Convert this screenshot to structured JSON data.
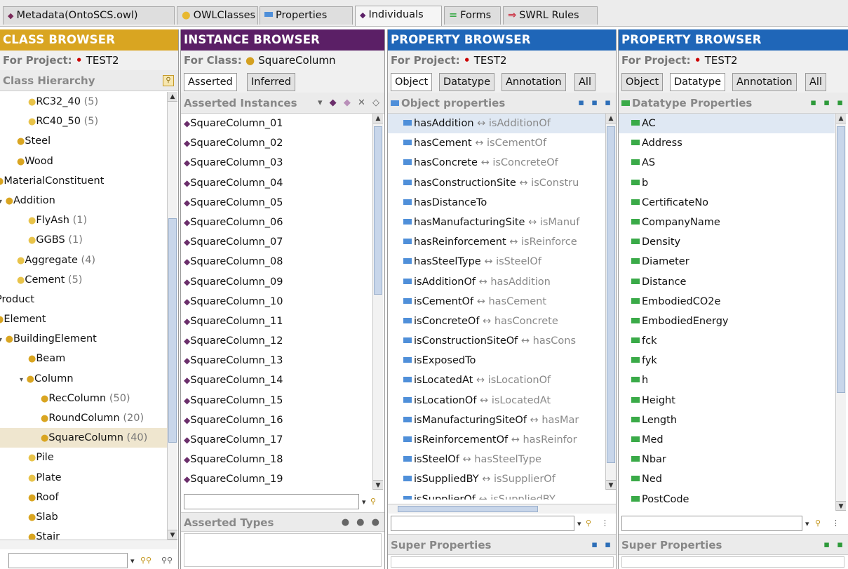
{
  "tabs": [
    {
      "label": "Metadata(OntoSCS.owl)",
      "icon": "purple-diamond"
    },
    {
      "label": "OWLClasses",
      "icon": "gold-circle"
    },
    {
      "label": "Properties",
      "icon": "blue-rect"
    },
    {
      "label": "Individuals",
      "icon": "purple-diamond",
      "active": true
    },
    {
      "label": "Forms",
      "icon": "green-lines"
    },
    {
      "label": "SWRL Rules",
      "icon": "red-arrow"
    }
  ],
  "class_browser": {
    "title": "CLASS BROWSER",
    "for_project_label": "For Project:",
    "project_name": "TEST2",
    "hierarchy_label": "Class Hierarchy",
    "items": [
      {
        "label": "RC32_40",
        "count": "(5)"
      },
      {
        "label": "RC40_50",
        "count": "(5)"
      },
      {
        "label": "Steel",
        "count": ""
      },
      {
        "label": "Wood",
        "count": ""
      },
      {
        "label": "MaterialConstituent",
        "count": ""
      },
      {
        "label": "Addition",
        "count": ""
      },
      {
        "label": "FlyAsh",
        "count": "(1)"
      },
      {
        "label": "GGBS",
        "count": "(1)"
      },
      {
        "label": "Aggregate",
        "count": "(4)"
      },
      {
        "label": "Cement",
        "count": "(5)"
      },
      {
        "label": "Product",
        "count": ""
      },
      {
        "label": "Element",
        "count": ""
      },
      {
        "label": "BuildingElement",
        "count": ""
      },
      {
        "label": "Beam",
        "count": ""
      },
      {
        "label": "Column",
        "count": ""
      },
      {
        "label": "RecColumn",
        "count": "(50)"
      },
      {
        "label": "RoundColumn",
        "count": "(20)"
      },
      {
        "label": "SquareColumn",
        "count": "(40)"
      },
      {
        "label": "Pile",
        "count": ""
      },
      {
        "label": "Plate",
        "count": ""
      },
      {
        "label": "Roof",
        "count": ""
      },
      {
        "label": "Slab",
        "count": ""
      },
      {
        "label": "Stair",
        "count": ""
      }
    ]
  },
  "instance_browser": {
    "title": "INSTANCE BROWSER",
    "for_class_label": "For Class:",
    "class_name": "SquareColumn",
    "tab_asserted": "Asserted",
    "tab_inferred": "Inferred",
    "instances_header": "Asserted Instances",
    "instances": [
      "SquareColumn_01",
      "SquareColumn_02",
      "SquareColumn_03",
      "SquareColumn_04",
      "SquareColumn_05",
      "SquareColumn_06",
      "SquareColumn_07",
      "SquareColumn_08",
      "SquareColumn_09",
      "SquareColumn_10",
      "SquareColumn_11",
      "SquareColumn_12",
      "SquareColumn_13",
      "SquareColumn_14",
      "SquareColumn_15",
      "SquareColumn_16",
      "SquareColumn_17",
      "SquareColumn_18",
      "SquareColumn_19"
    ],
    "types_header": "Asserted Types"
  },
  "property_browser_1": {
    "title": "PROPERTY BROWSER",
    "for_project_label": "For Project:",
    "project_name": "TEST2",
    "tabs": [
      "Object",
      "Datatype",
      "Annotation",
      "All"
    ],
    "active_tab": "Object",
    "list_header": "Object properties",
    "items": [
      {
        "name": "hasAddition",
        "inverse": "isAdditionOf"
      },
      {
        "name": "hasCement",
        "inverse": "isCementOf"
      },
      {
        "name": "hasConcrete",
        "inverse": "isConcreteOf"
      },
      {
        "name": "hasConstructionSite",
        "inverse": "isConstru"
      },
      {
        "name": "hasDistanceTo",
        "inverse": ""
      },
      {
        "name": "hasManufacturingSite",
        "inverse": "isManuf"
      },
      {
        "name": "hasReinforcement",
        "inverse": "isReinforce"
      },
      {
        "name": "hasSteelType",
        "inverse": "isSteelOf"
      },
      {
        "name": "isAdditionOf",
        "inverse": "hasAddition"
      },
      {
        "name": "isCementOf",
        "inverse": "hasCement"
      },
      {
        "name": "isConcreteOf",
        "inverse": "hasConcrete"
      },
      {
        "name": "isConstructionSiteOf",
        "inverse": "hasCons"
      },
      {
        "name": "isExposedTo",
        "inverse": ""
      },
      {
        "name": "isLocatedAt",
        "inverse": "isLocationOf"
      },
      {
        "name": "isLocationOf",
        "inverse": "isLocatedAt"
      },
      {
        "name": "isManufacturingSiteOf",
        "inverse": "hasMar"
      },
      {
        "name": "isReinforcementOf",
        "inverse": "hasReinfor"
      },
      {
        "name": "isSteelOf",
        "inverse": "hasSteelType"
      },
      {
        "name": "isSuppliedBY",
        "inverse": "isSupplierOf"
      },
      {
        "name": "isSupplierOf",
        "inverse": "isSuppliedBY"
      }
    ],
    "super_header": "Super Properties"
  },
  "property_browser_2": {
    "title": "PROPERTY BROWSER",
    "for_project_label": "For Project:",
    "project_name": "TEST2",
    "tabs": [
      "Object",
      "Datatype",
      "Annotation",
      "All"
    ],
    "active_tab": "Datatype",
    "list_header": "Datatype Properties",
    "items": [
      "AC",
      "Address",
      "AS",
      "b",
      "CertificateNo",
      "CompanyName",
      "Density",
      "Diameter",
      "Distance",
      "EmbodiedCO2e",
      "EmbodiedEnergy",
      "fck",
      "fyk",
      "h",
      "Height",
      "Length",
      "Med",
      "Nbar",
      "Ned",
      "PostCode"
    ],
    "super_header": "Super Properties"
  },
  "arrow_glyph": "↔",
  "colors": {
    "class_title_bg": "#d9a521",
    "instance_title_bg": "#5b1f66",
    "property_title_bg": "#1f66b8",
    "class_icon": "#d9a521",
    "instance_icon": "#6b2e6b",
    "object_prop_icon": "#4f8fd9",
    "datatype_prop_icon": "#3aaa48"
  },
  "icons": [
    "search-icon",
    "binoculars-icon",
    "dropdown-icon",
    "add-icon",
    "delete-icon"
  ]
}
